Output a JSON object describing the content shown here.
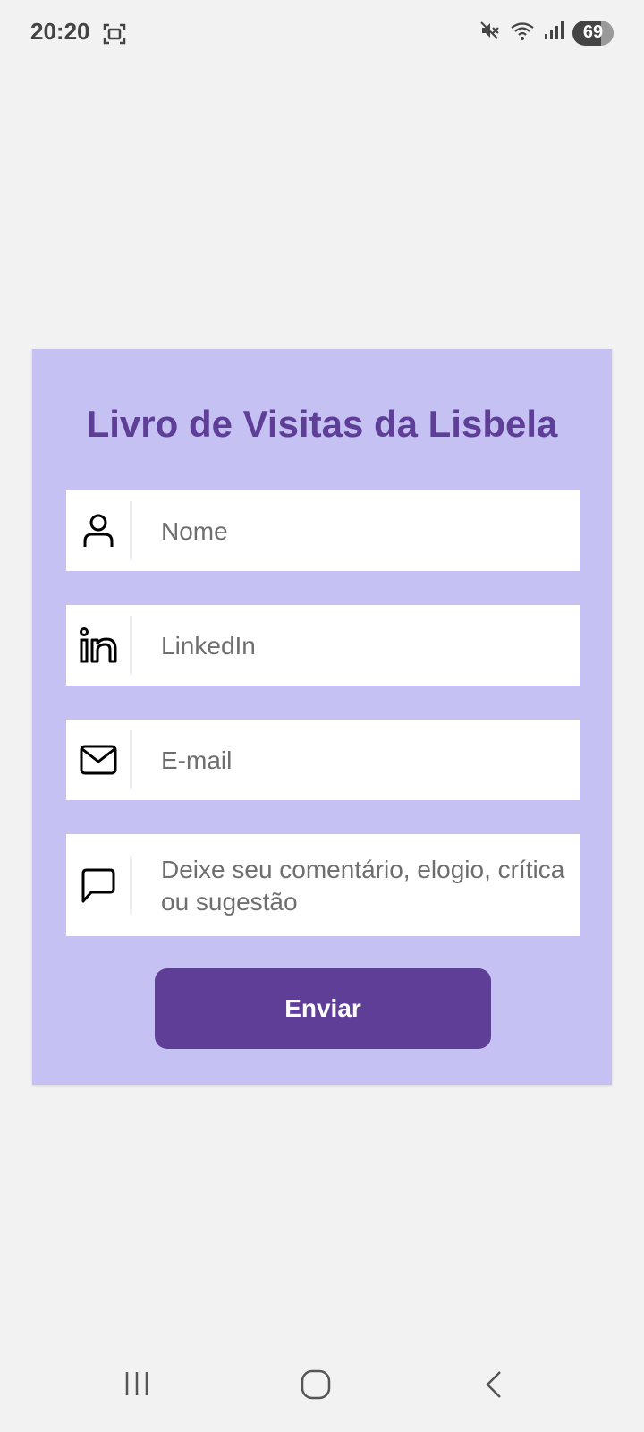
{
  "status_bar": {
    "time": "20:20",
    "battery": "69",
    "icons": [
      "screenshot-icon",
      "mute-icon",
      "wifi-icon",
      "signal-icon",
      "battery-icon"
    ]
  },
  "form": {
    "title": "Livro de Visitas da Lisbela",
    "fields": [
      {
        "icon": "person-icon",
        "placeholder": "Nome"
      },
      {
        "icon": "linkedin-icon",
        "placeholder": "LinkedIn"
      },
      {
        "icon": "mail-icon",
        "placeholder": "E-mail"
      },
      {
        "icon": "comment-icon",
        "placeholder": "Deixe seu comentário, elogio, crítica ou sugestão"
      }
    ],
    "submit_label": "Enviar"
  },
  "nav_bar": {
    "icons": [
      "recent-apps-icon",
      "home-icon",
      "back-icon"
    ]
  },
  "colors": {
    "background": "#f2f2f2",
    "card": "#c5c2f3",
    "accent": "#5f3e98",
    "field": "#ffffff"
  }
}
